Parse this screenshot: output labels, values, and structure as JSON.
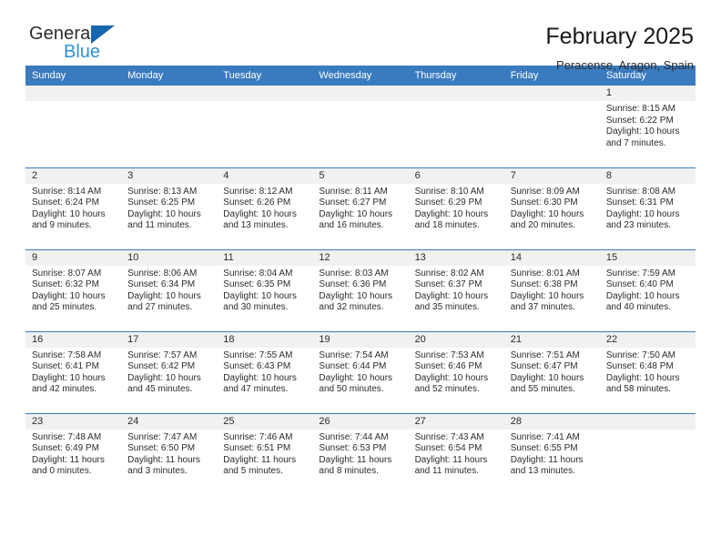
{
  "brand": {
    "name_top": "General",
    "name_bottom": "Blue",
    "accent_color": "#2e8fd8",
    "header_color": "#3a7bbf"
  },
  "header": {
    "title": "February 2025",
    "subtitle": "Peracense, Aragon, Spain"
  },
  "weekday_headers": [
    "Sunday",
    "Monday",
    "Tuesday",
    "Wednesday",
    "Thursday",
    "Friday",
    "Saturday"
  ],
  "labels": {
    "sunrise": "Sunrise:",
    "sunset": "Sunset:",
    "daylight": "Daylight:"
  },
  "weeks": [
    [
      {
        "day": "",
        "empty": true
      },
      {
        "day": "",
        "empty": true
      },
      {
        "day": "",
        "empty": true
      },
      {
        "day": "",
        "empty": true
      },
      {
        "day": "",
        "empty": true
      },
      {
        "day": "",
        "empty": true
      },
      {
        "day": "1",
        "sunrise": "Sunrise: 8:15 AM",
        "sunset": "Sunset: 6:22 PM",
        "daylight": "Daylight: 10 hours and 7 minutes."
      }
    ],
    [
      {
        "day": "2",
        "sunrise": "Sunrise: 8:14 AM",
        "sunset": "Sunset: 6:24 PM",
        "daylight": "Daylight: 10 hours and 9 minutes."
      },
      {
        "day": "3",
        "sunrise": "Sunrise: 8:13 AM",
        "sunset": "Sunset: 6:25 PM",
        "daylight": "Daylight: 10 hours and 11 minutes."
      },
      {
        "day": "4",
        "sunrise": "Sunrise: 8:12 AM",
        "sunset": "Sunset: 6:26 PM",
        "daylight": "Daylight: 10 hours and 13 minutes."
      },
      {
        "day": "5",
        "sunrise": "Sunrise: 8:11 AM",
        "sunset": "Sunset: 6:27 PM",
        "daylight": "Daylight: 10 hours and 16 minutes."
      },
      {
        "day": "6",
        "sunrise": "Sunrise: 8:10 AM",
        "sunset": "Sunset: 6:29 PM",
        "daylight": "Daylight: 10 hours and 18 minutes."
      },
      {
        "day": "7",
        "sunrise": "Sunrise: 8:09 AM",
        "sunset": "Sunset: 6:30 PM",
        "daylight": "Daylight: 10 hours and 20 minutes."
      },
      {
        "day": "8",
        "sunrise": "Sunrise: 8:08 AM",
        "sunset": "Sunset: 6:31 PM",
        "daylight": "Daylight: 10 hours and 23 minutes."
      }
    ],
    [
      {
        "day": "9",
        "sunrise": "Sunrise: 8:07 AM",
        "sunset": "Sunset: 6:32 PM",
        "daylight": "Daylight: 10 hours and 25 minutes."
      },
      {
        "day": "10",
        "sunrise": "Sunrise: 8:06 AM",
        "sunset": "Sunset: 6:34 PM",
        "daylight": "Daylight: 10 hours and 27 minutes."
      },
      {
        "day": "11",
        "sunrise": "Sunrise: 8:04 AM",
        "sunset": "Sunset: 6:35 PM",
        "daylight": "Daylight: 10 hours and 30 minutes."
      },
      {
        "day": "12",
        "sunrise": "Sunrise: 8:03 AM",
        "sunset": "Sunset: 6:36 PM",
        "daylight": "Daylight: 10 hours and 32 minutes."
      },
      {
        "day": "13",
        "sunrise": "Sunrise: 8:02 AM",
        "sunset": "Sunset: 6:37 PM",
        "daylight": "Daylight: 10 hours and 35 minutes."
      },
      {
        "day": "14",
        "sunrise": "Sunrise: 8:01 AM",
        "sunset": "Sunset: 6:38 PM",
        "daylight": "Daylight: 10 hours and 37 minutes."
      },
      {
        "day": "15",
        "sunrise": "Sunrise: 7:59 AM",
        "sunset": "Sunset: 6:40 PM",
        "daylight": "Daylight: 10 hours and 40 minutes."
      }
    ],
    [
      {
        "day": "16",
        "sunrise": "Sunrise: 7:58 AM",
        "sunset": "Sunset: 6:41 PM",
        "daylight": "Daylight: 10 hours and 42 minutes."
      },
      {
        "day": "17",
        "sunrise": "Sunrise: 7:57 AM",
        "sunset": "Sunset: 6:42 PM",
        "daylight": "Daylight: 10 hours and 45 minutes."
      },
      {
        "day": "18",
        "sunrise": "Sunrise: 7:55 AM",
        "sunset": "Sunset: 6:43 PM",
        "daylight": "Daylight: 10 hours and 47 minutes."
      },
      {
        "day": "19",
        "sunrise": "Sunrise: 7:54 AM",
        "sunset": "Sunset: 6:44 PM",
        "daylight": "Daylight: 10 hours and 50 minutes."
      },
      {
        "day": "20",
        "sunrise": "Sunrise: 7:53 AM",
        "sunset": "Sunset: 6:46 PM",
        "daylight": "Daylight: 10 hours and 52 minutes."
      },
      {
        "day": "21",
        "sunrise": "Sunrise: 7:51 AM",
        "sunset": "Sunset: 6:47 PM",
        "daylight": "Daylight: 10 hours and 55 minutes."
      },
      {
        "day": "22",
        "sunrise": "Sunrise: 7:50 AM",
        "sunset": "Sunset: 6:48 PM",
        "daylight": "Daylight: 10 hours and 58 minutes."
      }
    ],
    [
      {
        "day": "23",
        "sunrise": "Sunrise: 7:48 AM",
        "sunset": "Sunset: 6:49 PM",
        "daylight": "Daylight: 11 hours and 0 minutes."
      },
      {
        "day": "24",
        "sunrise": "Sunrise: 7:47 AM",
        "sunset": "Sunset: 6:50 PM",
        "daylight": "Daylight: 11 hours and 3 minutes."
      },
      {
        "day": "25",
        "sunrise": "Sunrise: 7:46 AM",
        "sunset": "Sunset: 6:51 PM",
        "daylight": "Daylight: 11 hours and 5 minutes."
      },
      {
        "day": "26",
        "sunrise": "Sunrise: 7:44 AM",
        "sunset": "Sunset: 6:53 PM",
        "daylight": "Daylight: 11 hours and 8 minutes."
      },
      {
        "day": "27",
        "sunrise": "Sunrise: 7:43 AM",
        "sunset": "Sunset: 6:54 PM",
        "daylight": "Daylight: 11 hours and 11 minutes."
      },
      {
        "day": "28",
        "sunrise": "Sunrise: 7:41 AM",
        "sunset": "Sunset: 6:55 PM",
        "daylight": "Daylight: 11 hours and 13 minutes."
      },
      {
        "day": "",
        "empty": true
      }
    ]
  ]
}
